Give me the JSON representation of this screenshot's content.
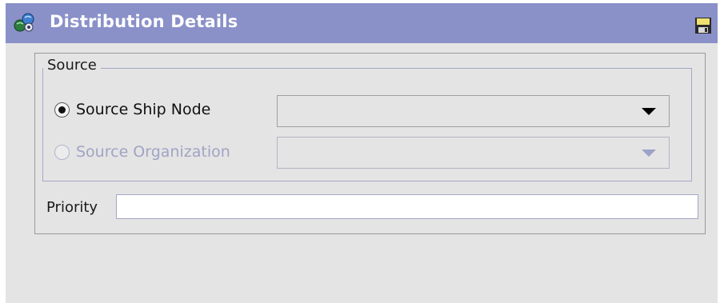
{
  "window": {
    "title": "Distribution Details",
    "title_icon": "distribution-nodes-icon",
    "save_icon": "floppy-disk-icon"
  },
  "source_group": {
    "legend": "Source",
    "options": [
      {
        "label": "Source Ship Node",
        "selected": true,
        "enabled": true,
        "value": ""
      },
      {
        "label": "Source Organization",
        "selected": false,
        "enabled": false,
        "value": ""
      }
    ]
  },
  "priority": {
    "label": "Priority",
    "value": ""
  },
  "colors": {
    "titlebar": "#8a90c8",
    "panel_background": "#e4e4e4",
    "disabled_text": "#a0a4c4"
  }
}
